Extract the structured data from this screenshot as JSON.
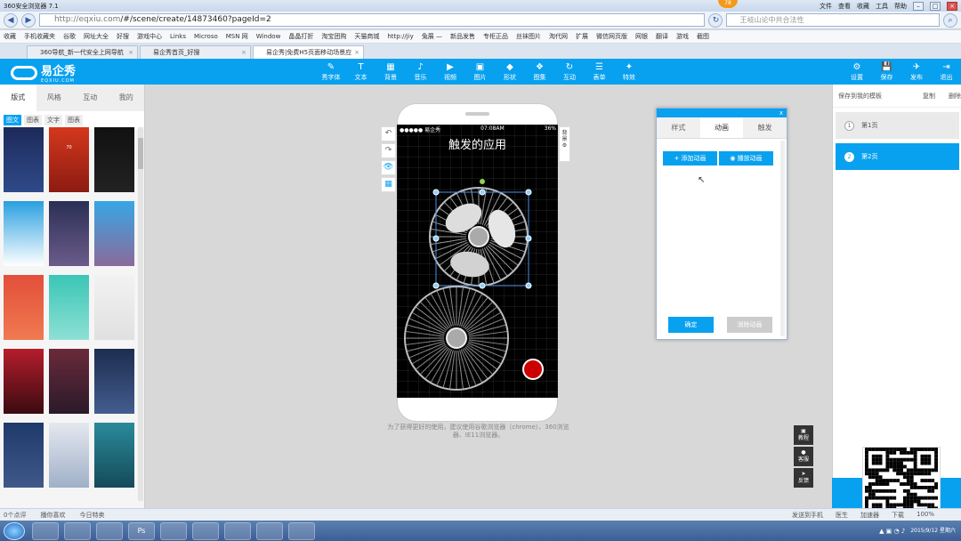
{
  "browser": {
    "title": "360安全浏览器 7.1",
    "menu": [
      "文件",
      "查看",
      "收藏",
      "工具",
      "帮助"
    ],
    "url_host": "http://eqxiu.com",
    "url_path": "/#/scene/create/14873460?pageId=2",
    "search_placeholder": "王岐山论中共合法性",
    "badge": "78"
  },
  "favorites": [
    "收藏",
    "手机收藏夹",
    "谷歌",
    "网址大全",
    "好搜",
    "游戏中心",
    "Links",
    "Microso",
    "MSN 网",
    "Window",
    "晶晶打折",
    "淘宝团购",
    "天猫商城",
    "http://jiy",
    "兔展 —",
    "新品发售",
    "专柜正品",
    "丝袜图片",
    "淘代网",
    "扩展",
    "微信网页版",
    "网银",
    "翻译",
    "游戏",
    "截图"
  ],
  "tabs": [
    "360导航_新一代安全上网导航",
    "易企秀首页_好搜",
    "易企秀|免费H5页面移动场景应"
  ],
  "app": {
    "logo": "易企秀",
    "logo_sub": "EQXIU.COM",
    "tools": [
      "秀字体",
      "文本",
      "背景",
      "音乐",
      "视频",
      "图片",
      "形状",
      "图集",
      "互动",
      "表单",
      "特效"
    ],
    "right_tools": [
      "设置",
      "保存",
      "发布",
      "退出"
    ]
  },
  "left": {
    "tabs": [
      "版式",
      "风格",
      "互动",
      "我的"
    ],
    "subtabs": [
      "图文",
      "图表",
      "文字",
      "图表"
    ],
    "thumbs": [
      {
        "c1": "#1d2a5a",
        "c2": "#2f4a8a",
        "t": ""
      },
      {
        "c1": "#d4381c",
        "c2": "#8c1b12",
        "t": "70"
      },
      {
        "c1": "#111",
        "c2": "#222",
        "t": ""
      },
      {
        "c1": "#2aa0e0",
        "c2": "#fff",
        "t": ""
      },
      {
        "c1": "#2b2f55",
        "c2": "#6b5b8a",
        "t": ""
      },
      {
        "c1": "#38a6e6",
        "c2": "#8a6a9a",
        "t": ""
      },
      {
        "c1": "#e24f3b",
        "c2": "#f07a50",
        "t": ""
      },
      {
        "c1": "#3ac6b6",
        "c2": "#8ee0d4",
        "t": ""
      },
      {
        "c1": "#f2f2f2",
        "c2": "#e0e0e0",
        "t": ""
      },
      {
        "c1": "#b51d2c",
        "c2": "#3a0b10",
        "t": ""
      },
      {
        "c1": "#6a2a3a",
        "c2": "#2a1a2a",
        "t": ""
      },
      {
        "c1": "#1c2d4f",
        "c2": "#445d8f",
        "t": ""
      },
      {
        "c1": "#1e3a6a",
        "c2": "#40588a",
        "t": ""
      },
      {
        "c1": "#e4e8f0",
        "c2": "#a0b0c8",
        "t": ""
      },
      {
        "c1": "#2a8a9a",
        "c2": "#154a5a",
        "t": ""
      }
    ]
  },
  "phone": {
    "carrier": "●●●●● 易企秀",
    "time": "07:08AM",
    "battery": "36%",
    "title": "触发的应用",
    "rbar": "背景"
  },
  "side_tools": [
    "↶",
    "↷",
    "👁",
    "▦"
  ],
  "hint": "为了获得更好的使用，建议使用谷歌浏览器（chrome）、360浏览器、IE11浏览器。",
  "dialog": {
    "tabs": [
      "样式",
      "动画",
      "触发"
    ],
    "add": "+ 添加动画",
    "play": "播放动画",
    "ok": "确定",
    "cancel": "消除动画"
  },
  "right": {
    "save_template": "保存到我的模板",
    "copy": "复制",
    "delete": "删除",
    "pages": [
      {
        "num": "1",
        "label": "第1页"
      },
      {
        "num": "2",
        "label": "第2页"
      }
    ]
  },
  "float": [
    "教程",
    "客服",
    "反馈"
  ],
  "statusbar": {
    "left": [
      "0个点评",
      "播你喜欢",
      "今日特卖"
    ],
    "right": [
      "发送到手机",
      "医生",
      "加速器",
      "下载",
      "100%"
    ]
  },
  "taskbar": {
    "apps": [
      "",
      "",
      "",
      "Ps",
      "",
      "",
      "",
      "",
      ""
    ],
    "date": "2015/9/12 星期六"
  },
  "colors": {
    "accent": "#08a1ef",
    "selected_page": "#08a1ef"
  }
}
